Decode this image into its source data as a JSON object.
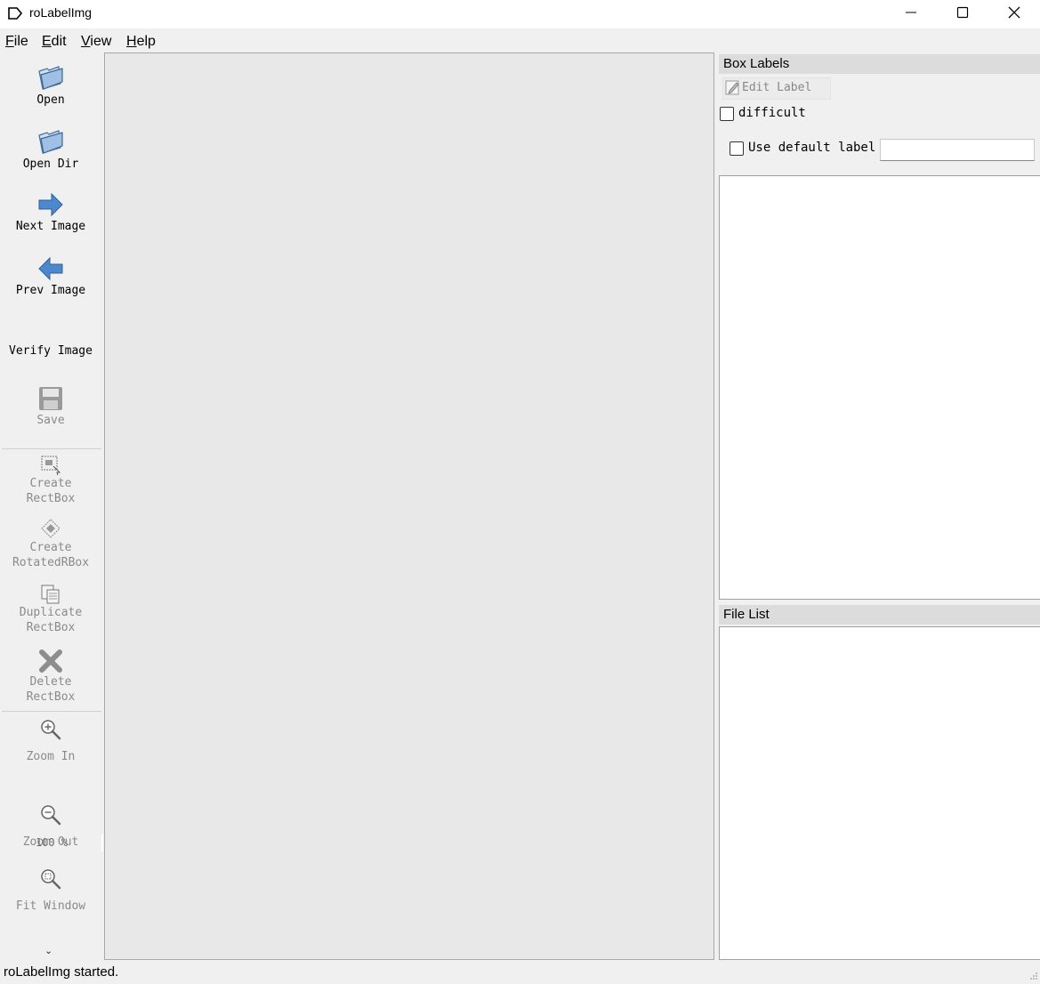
{
  "window": {
    "title": "roLabelImg",
    "icon": "tag-icon",
    "controls": [
      "minimize-icon",
      "maximize-icon",
      "close-icon"
    ]
  },
  "menu": [
    {
      "label": "File",
      "mnemonic": "F"
    },
    {
      "label": "Edit",
      "mnemonic": "E"
    },
    {
      "label": "View",
      "mnemonic": "V"
    },
    {
      "label": "Help",
      "mnemonic": "H"
    }
  ],
  "toolbar": {
    "open": {
      "label": "Open",
      "icon": "folder-open-icon"
    },
    "open_dir": {
      "label": "Open Dir",
      "icon": "folder-open-icon"
    },
    "next_image": {
      "label": "Next Image",
      "icon": "arrow-right-icon"
    },
    "prev_image": {
      "label": "Prev Image",
      "icon": "arrow-left-icon"
    },
    "verify_image": {
      "label": "Verify Image"
    },
    "save": {
      "label": "Save",
      "icon": "floppy-disk-icon"
    },
    "create_rectbox": {
      "label_1": "Create",
      "label_2": "RectBox",
      "icon": "draw-rect-icon"
    },
    "create_rotated": {
      "label_1": "Create",
      "label_2": "RotatedRBox",
      "icon": "draw-rotated-icon"
    },
    "duplicate": {
      "label_1": "Duplicate",
      "label_2": "RectBox",
      "icon": "copy-icon"
    },
    "delete": {
      "label_1": "Delete",
      "label_2": "RectBox",
      "icon": "cross-icon"
    },
    "zoom_in": {
      "label": "Zoom In",
      "icon": "zoom-in-icon"
    },
    "zoom_value": "100 %",
    "zoom_out": {
      "label": "Zoom Out",
      "icon": "zoom-out-icon"
    },
    "fit_window": {
      "label": "Fit Window",
      "icon": "fit-window-icon"
    },
    "extension_arrow": "⌄"
  },
  "box_labels_panel": {
    "title": "Box Labels",
    "edit_label_button": "Edit Label",
    "difficult_label": "difficult",
    "difficult_checked": false,
    "use_default_label": "Use default label",
    "use_default_checked": false,
    "default_label_value": ""
  },
  "file_list_panel": {
    "title": "File List",
    "files": []
  },
  "status": {
    "message": "roLabelImg started."
  }
}
